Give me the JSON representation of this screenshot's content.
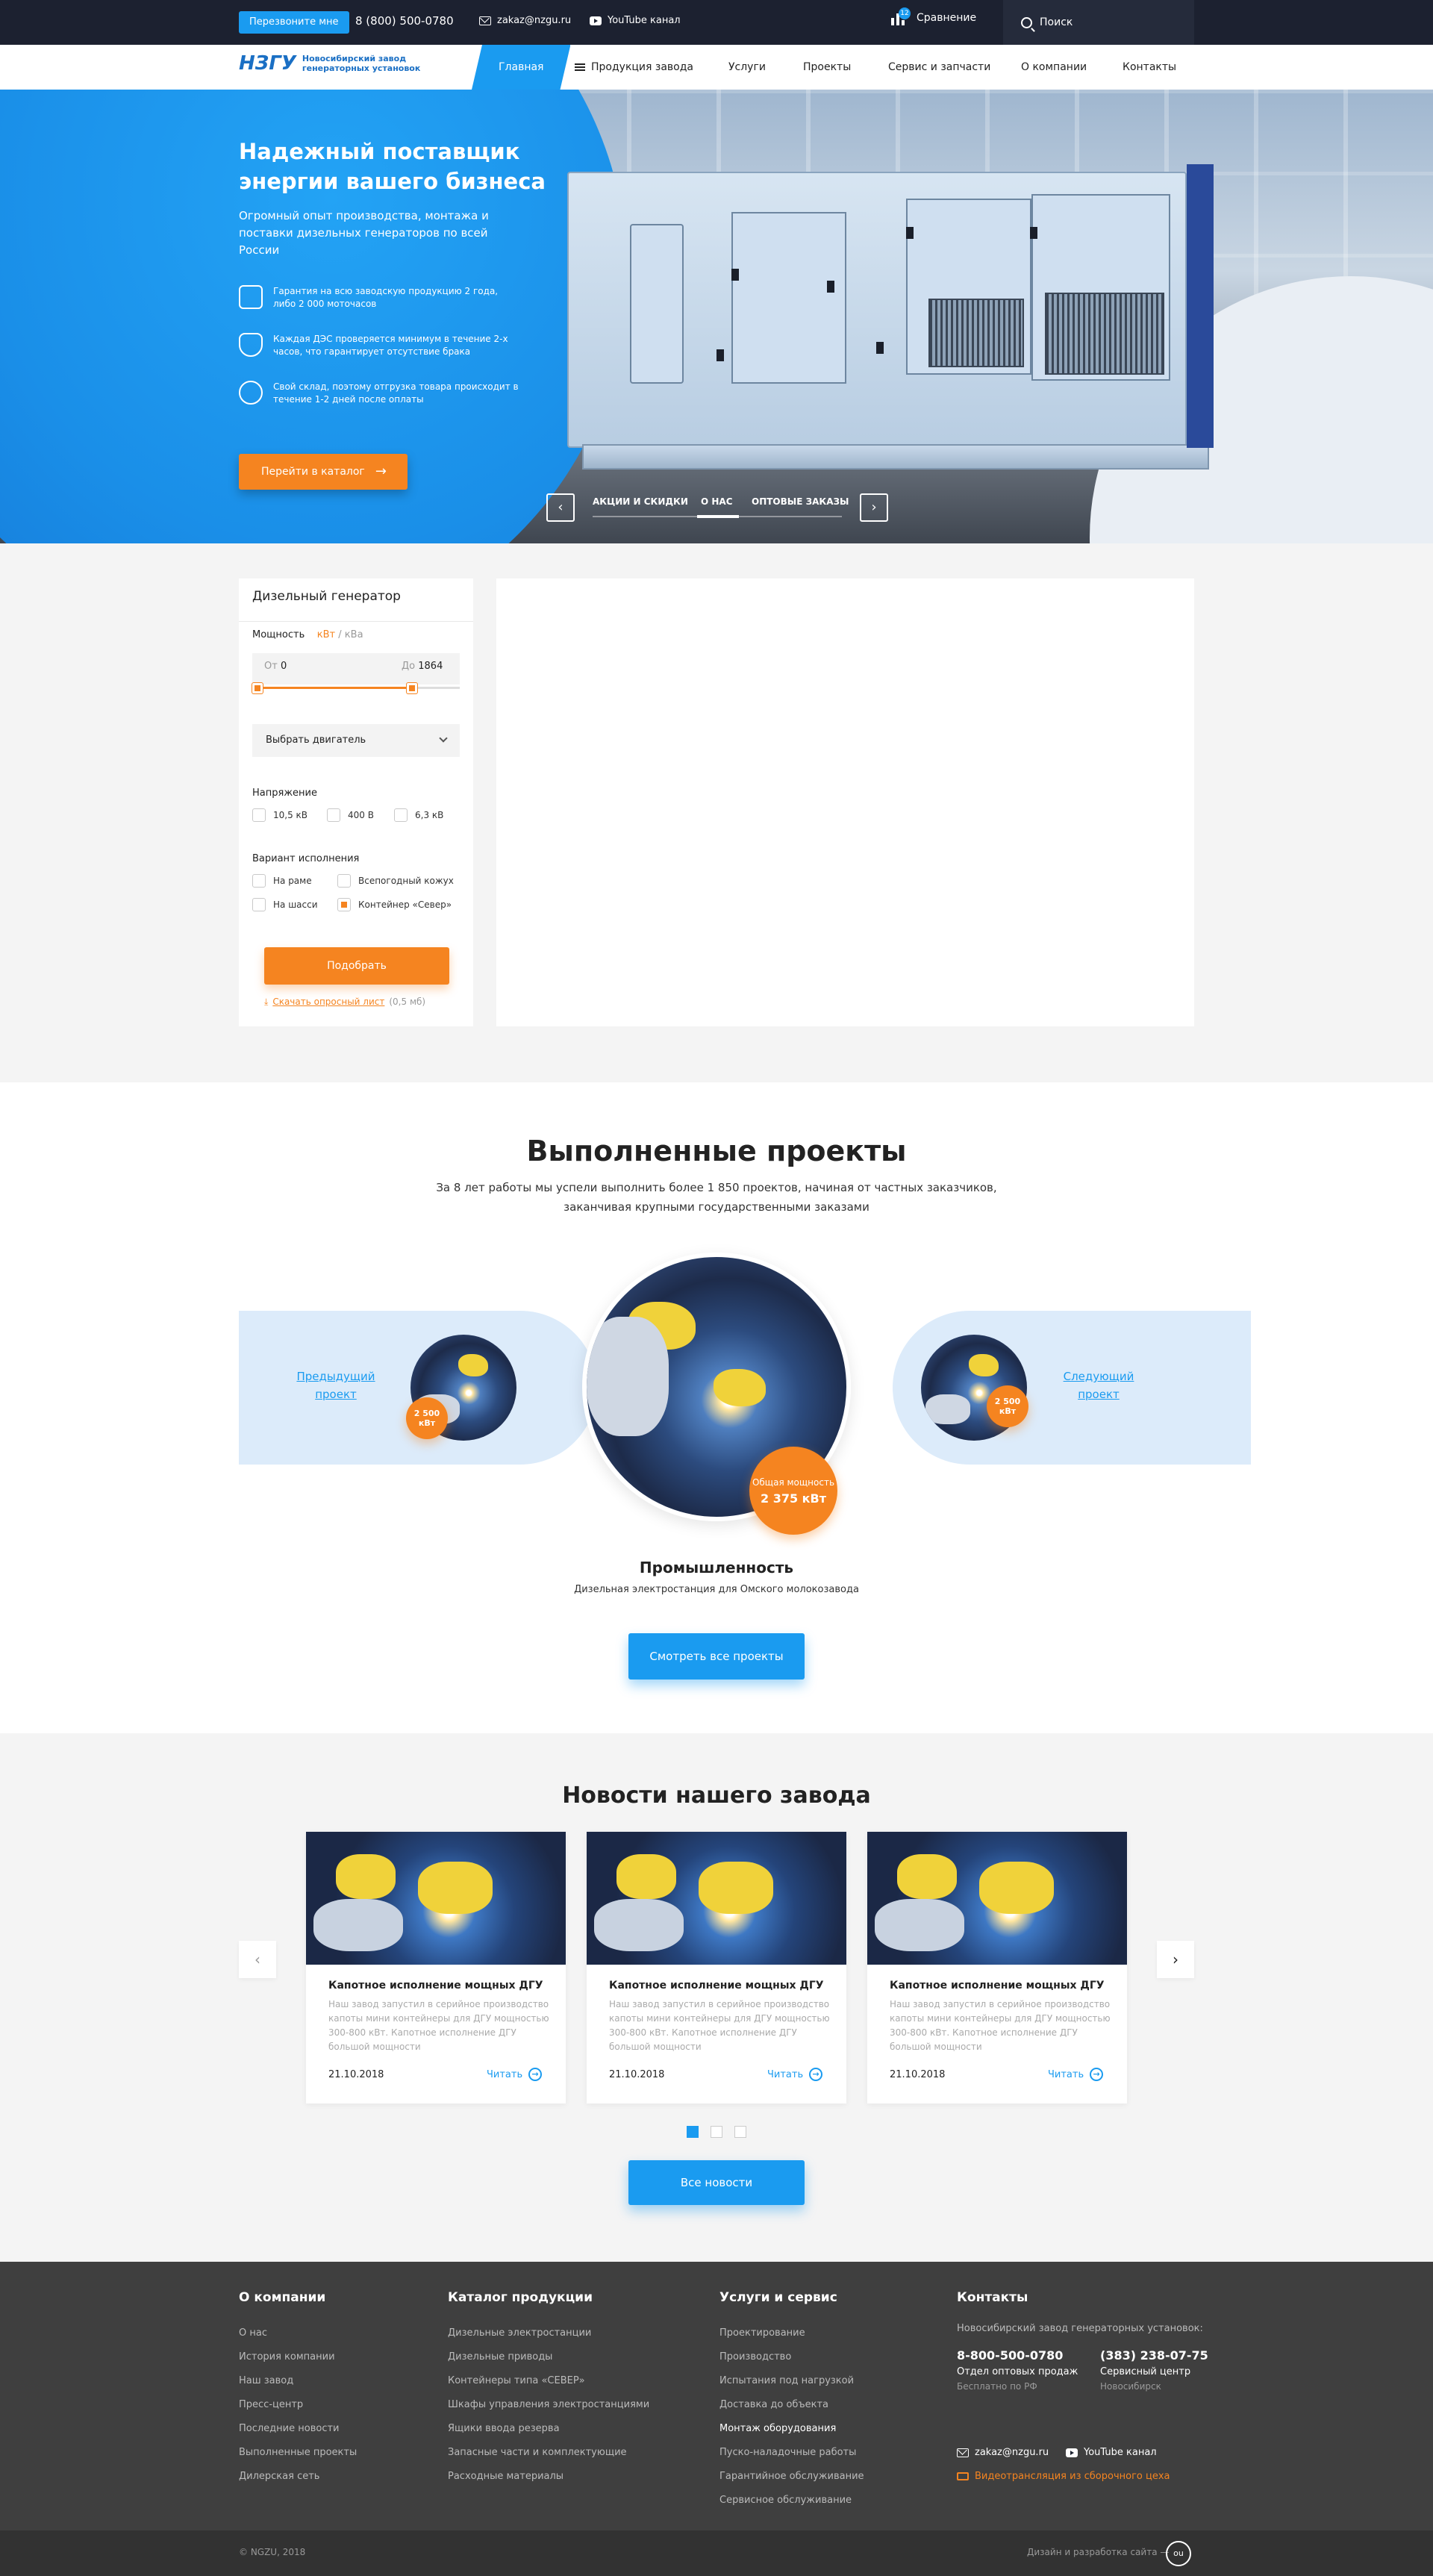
{
  "topbar": {
    "call_button": "Перезвоните мне",
    "phone": "8 (800) 500-0780",
    "email": "zakaz@nzgu.ru",
    "youtube": "YouTube канал",
    "compare_label": "Сравнение",
    "compare_count": "12",
    "search_placeholder": "Поиск"
  },
  "logo": {
    "mark": "НЗГУ",
    "line1": "Новосибирский завод",
    "line2": "генераторных установок"
  },
  "nav": {
    "items": [
      "Главная",
      "Продукция завода",
      "Услуги",
      "Проекты",
      "Сервис и запчасти",
      "О компании",
      "Контакты"
    ]
  },
  "hero": {
    "title": "Надежный поставщик энергии вашего бизнеса",
    "lead": "Огромный опыт производства, монтажа и поставки дизельных генераторов по всей России",
    "features": [
      "Гарантия на всю заводскую продукцию 2 года, либо 2 000 моточасов",
      "Каждая ДЭС проверяется минимум в течение 2-х часов, что гарантирует отсутствие брака",
      "Свой склад, поэтому отгрузка товара происходит в течение 1-2 дней после оплаты"
    ],
    "cta": "Перейти в каталог",
    "slides": [
      "АКЦИИ И СКИДКИ",
      "О НАС",
      "ОПТОВЫЕ ЗАКАЗЫ"
    ]
  },
  "filter": {
    "title": "Дизельный генератор",
    "power_label": "Мощность",
    "unit_kw": "кВт",
    "unit_sep": "/",
    "unit_kva": "кВа",
    "from_label": "От",
    "from_value": "0",
    "to_label": "До",
    "to_value": "1864",
    "range_fraction": 0.75,
    "engine_select": "Выбрать двигатель",
    "voltage_label": "Напряжение",
    "voltages": [
      "10,5 кВ",
      "400 В",
      "6,3 кВ"
    ],
    "variant_label": "Вариант исполнения",
    "variants": [
      "На раме",
      "Всепогодный кожух",
      "На шасси",
      "Контейнер «Север»"
    ],
    "submit": "Подобрать",
    "download": "Скачать опросный лист",
    "download_size": "(0,5 мб)"
  },
  "projects": {
    "title": "Выполненные проекты",
    "subtitle": "За 8 лет работы мы успели выполнить более 1 850 проектов, начиная от частных заказчиков, заканчивая крупными государственными заказами",
    "prev": "Предыдущий проект",
    "next": "Следующий проект",
    "prev_badge": "2 500 кВт",
    "next_badge": "2 500 кВт",
    "main_badge_label": "Общая мощность",
    "main_badge_value": "2 375 кВт",
    "item_title": "Промышленность",
    "item_desc": "Дизельная электростанция для Омского молокозавода",
    "button": "Смотреть все проекты"
  },
  "news": {
    "title": "Новости нашего завода",
    "cards": [
      {
        "title": "Капотное исполнение мощных ДГУ",
        "text": "Наш завод запустил в серийное производство капоты мини контейнеры для ДГУ мощностью 300-800 кВт. Капотное исполнение ДГУ большой мощности",
        "date": "21.10.2018",
        "read": "Читать"
      },
      {
        "title": "Капотное исполнение мощных ДГУ",
        "text": "Наш завод запустил в серийное производство капоты мини контейнеры для ДГУ мощностью 300-800 кВт. Капотное исполнение ДГУ большой мощности",
        "date": "21.10.2018",
        "read": "Читать"
      },
      {
        "title": "Капотное исполнение мощных ДГУ",
        "text": "Наш завод запустил в серийное производство капоты мини контейнеры для ДГУ мощностью 300-800 кВт. Капотное исполнение ДГУ большой мощности",
        "date": "21.10.2018",
        "read": "Читать"
      }
    ],
    "button": "Все новости"
  },
  "footer": {
    "about": {
      "title": "О компании",
      "links": [
        "О нас",
        "История компании",
        "Наш завод",
        "Пресс-центр",
        "Последние новости",
        "Выполненные проекты",
        "Дилерская сеть"
      ]
    },
    "catalog": {
      "title": "Каталог продукции",
      "links": [
        "Дизельные электростанции",
        "Дизельные приводы",
        "Контейнеры типа «СЕВЕР»",
        "Шкафы управления электростанциями",
        "Ящики ввода резерва",
        "Запасные части и комплектующие",
        "Расходные материалы"
      ]
    },
    "services": {
      "title": "Услуги и сервис",
      "links": [
        "Проектирование",
        "Производство",
        "Испытания под нагрузкой",
        "Доставка до объекта",
        "Монтаж оборудования",
        "Пуско-наладочные работы",
        "Гарантийное обслуживание",
        "Сервисное обслуживание"
      ]
    },
    "contacts": {
      "title": "Контакты",
      "company": "Новосибирский завод генераторных установок:",
      "phone1": "8-800-500-0780",
      "phone1_label": "Отдел оптовых продаж",
      "phone1_note": "Бесплатно по РФ",
      "phone2": "(383) 238-07-75",
      "phone2_label": "Сервисный центр",
      "phone2_note": "Новосибирск",
      "email": "zakaz@nzgu.ru",
      "youtube": "YouTube канал",
      "stream": "Видеотрансляция из сборочного цеха"
    },
    "copyright": "© NGZU, 2018",
    "design": "Дизайн и разработка сайта —",
    "design_logo": "ou"
  }
}
